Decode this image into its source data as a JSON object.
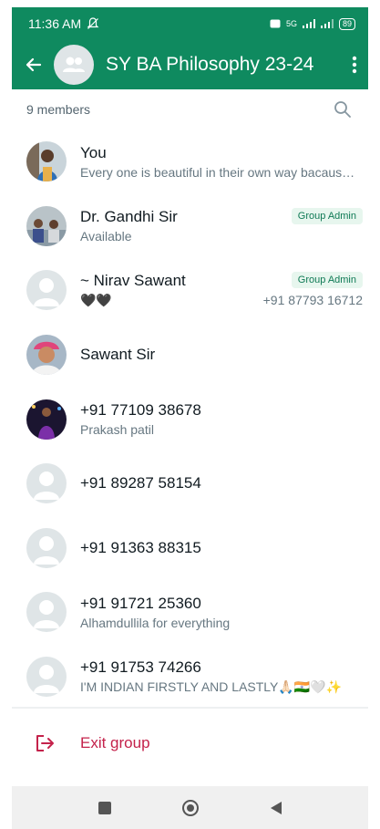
{
  "status_bar": {
    "time": "11:36 AM",
    "network": "5G",
    "battery": "89"
  },
  "header": {
    "back_icon": "arrow-left-icon",
    "group_name": "SY BA Philosophy 23-24",
    "menu_icon": "more-vert-icon"
  },
  "members_bar": {
    "count_label": "9 members",
    "search_icon": "search-icon"
  },
  "members": [
    {
      "name": "You",
      "about": "Every one is beautiful in their own way bacause..."
    },
    {
      "name": "Dr. Gandhi Sir",
      "about": "Available",
      "badge": "Group Admin"
    },
    {
      "name": "~ Nirav Sawant",
      "about": "🖤🖤",
      "badge": "Group Admin",
      "phone": "+91 87793 16712"
    },
    {
      "name": "Sawant Sir"
    },
    {
      "name": "+91 77109 38678",
      "about": "Prakash patil"
    },
    {
      "name": "+91 89287 58154"
    },
    {
      "name": "+91 91363 88315"
    },
    {
      "name": "+91 91721 25360",
      "about": "Alhamdullila for everything"
    },
    {
      "name": "+91 91753 74266",
      "about": "I'M INDIAN FIRSTLY AND LASTLY🙏🏻🇮🇳🤍✨"
    }
  ],
  "exit": {
    "label": "Exit group",
    "icon": "exit-icon"
  },
  "colors": {
    "primary": "#0f8a5f",
    "danger": "#c4224b",
    "admin_badge_bg": "#e7f6ee"
  }
}
